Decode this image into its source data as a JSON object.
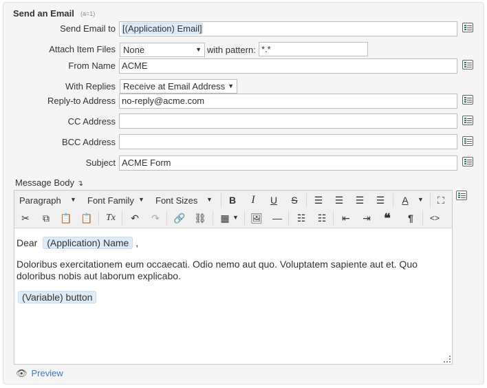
{
  "section": {
    "title": "Send an Email",
    "hint": "(a=1)"
  },
  "fields": {
    "send_to": {
      "label": "Send Email to",
      "value": "[(Application) Email]"
    },
    "attach": {
      "label": "Attach Item Files",
      "value": "None",
      "pattern_label": "with pattern:",
      "pattern_value": "*.*"
    },
    "from_name": {
      "label": "From Name",
      "value": "ACME"
    },
    "with_replies": {
      "label": "With Replies",
      "value": "Receive at Email Address"
    },
    "reply_to": {
      "label": "Reply-to Address",
      "value": "no-reply@acme.com"
    },
    "cc": {
      "label": "CC Address",
      "value": ""
    },
    "bcc": {
      "label": "BCC Address",
      "value": ""
    },
    "subject": {
      "label": "Subject",
      "value": "ACME Form"
    }
  },
  "message_body": {
    "label": "Message Body",
    "toolbar": {
      "paragraph": "Paragraph",
      "font_family": "Font Family",
      "font_sizes": "Font Sizes"
    },
    "content": {
      "greeting": "Dear",
      "name_token": "(Application) Name",
      "greeting_tail": ",",
      "paragraph": "Doloribus exercitationem eum occaecati. Odio nemo aut quo. Voluptatem sapiente aut et. Quo doloribus nobis aut laborum explicabo.",
      "button_token": "(Variable) button"
    }
  },
  "preview": {
    "label": "Preview"
  }
}
